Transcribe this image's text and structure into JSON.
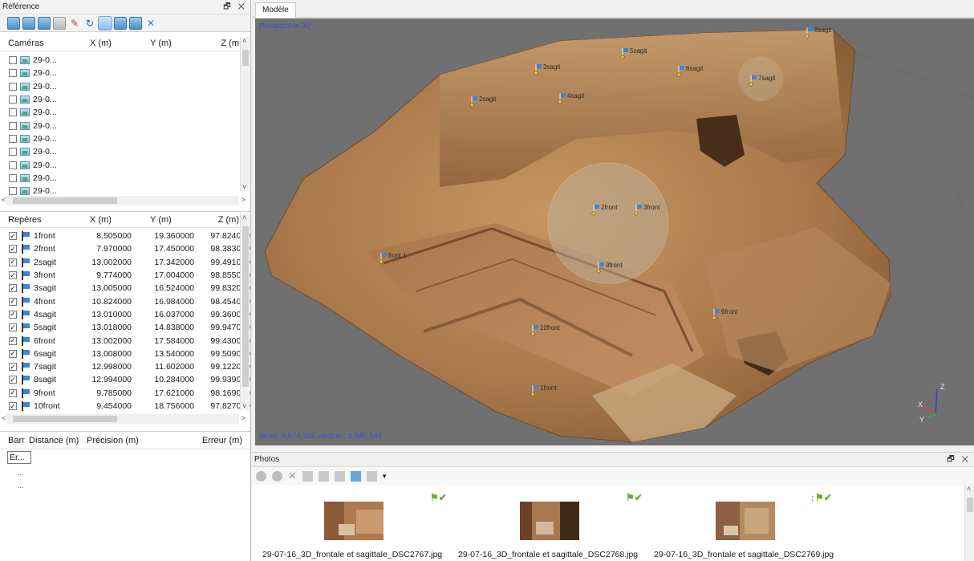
{
  "reference_panel": {
    "title": "Référence",
    "controls": "🗗 ✕",
    "cameras": {
      "headers": [
        "Caméras",
        "X (m)",
        "Y (m)",
        "Z (m"
      ],
      "items": [
        "29-0...",
        "29-0...",
        "29-0...",
        "29-0...",
        "29-0...",
        "29-0...",
        "29-0...",
        "29-0...",
        "29-0...",
        "29-0...",
        "29-0..."
      ]
    },
    "markers": {
      "headers": [
        "Repères",
        "X (m)",
        "Y (m)",
        "Z (m)"
      ],
      "rows": [
        {
          "name": "1front",
          "x": "8.505000",
          "y": "19.360000",
          "z": "97.824000"
        },
        {
          "name": "2front",
          "x": "7.970000",
          "y": "17.450000",
          "z": "98.383000"
        },
        {
          "name": "2sagit",
          "x": "13.002000",
          "y": "17.342000",
          "z": "99.491000"
        },
        {
          "name": "3front",
          "x": "9.774000",
          "y": "17.004000",
          "z": "98.855000"
        },
        {
          "name": "3sagit",
          "x": "13.005000",
          "y": "16.524000",
          "z": "99.832000"
        },
        {
          "name": "4front",
          "x": "10.824000",
          "y": "16.984000",
          "z": "98.454000"
        },
        {
          "name": "4sagit",
          "x": "13.010000",
          "y": "16.037000",
          "z": "99.360000"
        },
        {
          "name": "5sagit",
          "x": "13.018000",
          "y": "14.838000",
          "z": "99.947000"
        },
        {
          "name": "6front",
          "x": "13.002000",
          "y": "17.584000",
          "z": "99.430000"
        },
        {
          "name": "6sagit",
          "x": "13.008000",
          "y": "13.540000",
          "z": "99.509000"
        },
        {
          "name": "7sagit",
          "x": "12.998000",
          "y": "11.602000",
          "z": "99.122000"
        },
        {
          "name": "8sagit",
          "x": "12.994000",
          "y": "10.284000",
          "z": "99.939000"
        },
        {
          "name": "9front",
          "x": "9.785000",
          "y": "17.621000",
          "z": "98.169000"
        },
        {
          "name": "10front",
          "x": "9.454000",
          "y": "18.756000",
          "z": "97.827000"
        }
      ]
    },
    "scalebars": {
      "headers": [
        "Barr",
        "Distance (m)",
        "Précision (m)",
        "Erreur (m)"
      ],
      "first_cell": "Er...",
      "items": [
        "...",
        "..."
      ]
    }
  },
  "model_panel": {
    "tab": "Modèle",
    "perspective": "Perspective 30°",
    "stats": "faces: 5,674,326 vertices: 2,846,548",
    "axes": {
      "x": "X",
      "y": "Y",
      "z": "Z"
    },
    "markers": [
      {
        "label": "8sagit"
      },
      {
        "label": "5sagit"
      },
      {
        "label": "3sagit"
      },
      {
        "label": "6sagit"
      },
      {
        "label": "7sagit"
      },
      {
        "label": "2sagit"
      },
      {
        "label": "4sagit"
      },
      {
        "label": "3front"
      },
      {
        "label": "2front"
      },
      {
        "label": "front 1"
      },
      {
        "label": "9front"
      },
      {
        "label": "6front"
      },
      {
        "label": "10front"
      },
      {
        "label": "1front"
      }
    ]
  },
  "photos_panel": {
    "title": "Photos",
    "controls": "🗗 ✕",
    "photos": [
      {
        "label": "29-07-16_3D_frontale et sagittale_DSC2767.jpg"
      },
      {
        "label": "29-07-16_3D_frontale et sagittale_DSC2768.jpg"
      },
      {
        "label": "29-07-16_3D_frontale et sagittale_DSC2769.jpg"
      }
    ]
  },
  "colors": {
    "accent": "#3a86d8",
    "viewport_bg": "#707070",
    "marker_point": "#f2c230"
  }
}
